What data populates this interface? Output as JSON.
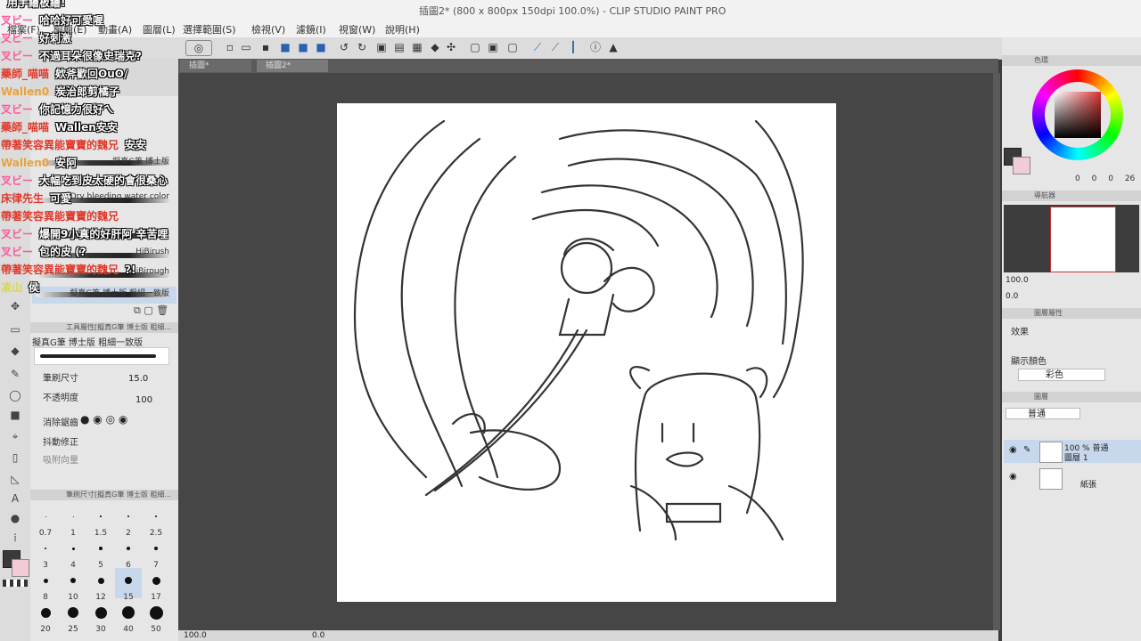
{
  "app": {
    "window_title": "插圖2* (800 x 800px 150dpi 100.0%) - CLIP STUDIO PAINT PRO",
    "menu": [
      "檔案(F)",
      "編輯(E)",
      "動畫(A)",
      "圖層(L)",
      "選擇範圍(S)",
      "檢視(V)",
      "濾鏡(I)",
      "視窗(W)",
      "說明(H)"
    ],
    "tabs": [
      "插圖*",
      "插圖2*"
    ]
  },
  "left_panel": {
    "brushes": [
      "擬真G筆 博士版",
      "Dry bleeding water color",
      "HiBispen",
      "HiBirush",
      "HiBirough",
      "擬真G筆 博士版 粗細一致版"
    ],
    "tool_prop_header": "工具屬性[擬真G筆 博士版 粗細...",
    "tool_prop_name": "擬真G筆 博士版 粗細一致版",
    "brush_size_label": "筆刷尺寸",
    "brush_size_value": "15.0",
    "opacity_label": "不透明度",
    "opacity_value": "100",
    "anti_alias_label": "消除鋸齒",
    "stabilize_label": "抖動修正",
    "snap_label": "吸附向量",
    "size_panel_header": "筆刷尺寸[擬真G筆 博士版 粗細...",
    "sizes": [
      "0.7",
      "1",
      "1.5",
      "2",
      "2.5",
      "3",
      "4",
      "5",
      "6",
      "7",
      "8",
      "10",
      "12",
      "15",
      "17",
      "20",
      "25",
      "30",
      "40",
      "50"
    ]
  },
  "status": {
    "zoom": "100.0",
    "angle": "0.0"
  },
  "right_panel": {
    "color_tab": "色環",
    "color_values": [
      "0",
      "0",
      "0",
      "26"
    ],
    "navigator_tab": "導航器",
    "nav_zoom": "100.0",
    "nav_angle": "0.0",
    "layer_prop_tab": "圖層屬性",
    "effect_label": "效果",
    "display_color_label": "顯示顏色",
    "display_color_value": "彩色",
    "layer_tab": "圖層",
    "blend_mode": "普通",
    "layers": [
      {
        "opacity_mode": "100 % 普通",
        "name": "圖層 1"
      },
      {
        "opacity_mode": "",
        "name": "紙張"
      }
    ]
  },
  "chat": [
    {
      "user": "",
      "text": "用手繪板繪!",
      "color": "#ff6b6b"
    },
    {
      "user": "叉ビー",
      "text": "哈哈好可愛喔",
      "color": "#ff5a9e"
    },
    {
      "user": "叉ビー",
      "text": "好刺激",
      "color": "#ff5a9e"
    },
    {
      "user": "叉ビー",
      "text": "不過耳朵很像史瑞克?",
      "color": "#ff5a9e"
    },
    {
      "user": "藥師_喵喵",
      "text": "欸斧歡回OuO/",
      "color": "#e0392b"
    },
    {
      "user": "Wallen0",
      "text": "炭治郎剪橘子",
      "color": "#e8a33a"
    },
    {
      "user": "叉ビー",
      "text": "你記憶力很好ㄟ",
      "color": "#ff5a9e"
    },
    {
      "user": "藥師_喵喵",
      "text": "Wallen安安",
      "color": "#e0392b"
    },
    {
      "user": "帶著笑容異能寶寶的魏兄",
      "text": "安安",
      "color": "#e0392b"
    },
    {
      "user": "Wallen0",
      "text": "安阿",
      "color": "#e8a33a"
    },
    {
      "user": "叉ビー",
      "text": "大幅吃到皮太硬的會很桑心",
      "color": "#ff5a9e"
    },
    {
      "user": "床律先生",
      "text": "可愛",
      "color": "#e0392b"
    },
    {
      "user": "帶著笑容異能寶寶的魏兄",
      "text": "",
      "color": "#e0392b"
    },
    {
      "user": "叉ビー",
      "text": "爆開9小真的好肝阿 辛苦哩",
      "color": "#ff5a9e"
    },
    {
      "user": "叉ビー",
      "text": "包的皮 (?",
      "color": "#ff5a9e"
    },
    {
      "user": "帶著笑容異能寶寶的魏兄",
      "text": "?!",
      "color": "#e0392b"
    },
    {
      "user": "凌山",
      "text": "侯",
      "color": "#d8d84a"
    }
  ]
}
